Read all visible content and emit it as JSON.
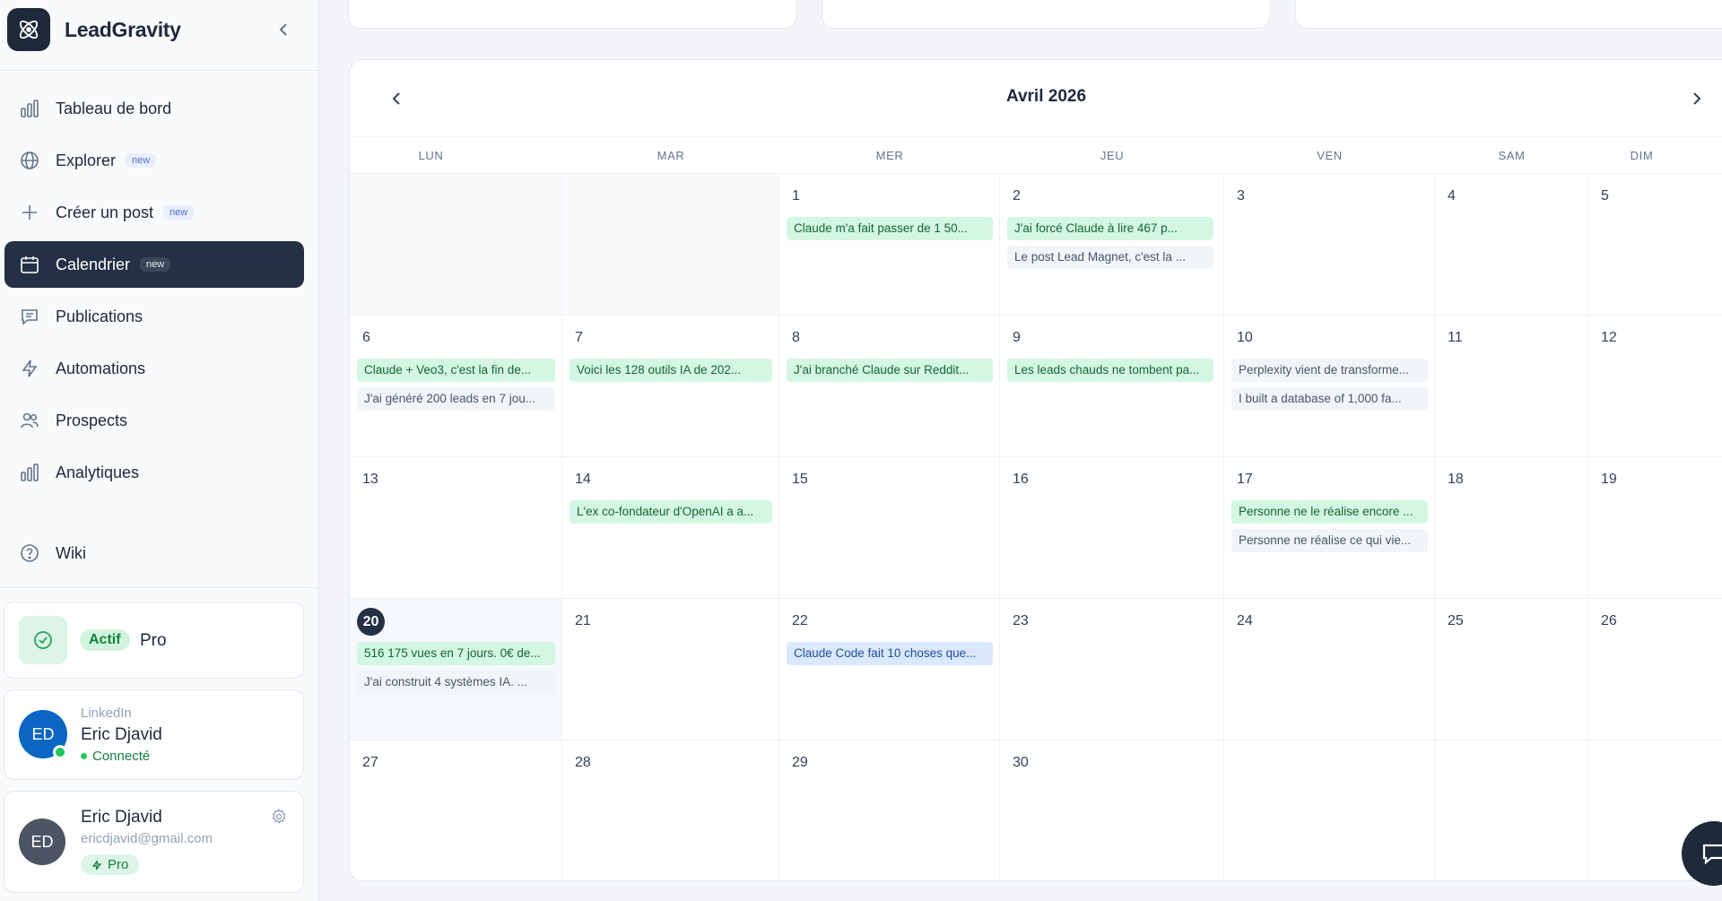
{
  "brand": {
    "name": "LeadGravity"
  },
  "nav": {
    "items": [
      {
        "id": "dashboard",
        "label": "Tableau de bord",
        "icon": "bar-chart-icon",
        "badge": ""
      },
      {
        "id": "explore",
        "label": "Explorer",
        "icon": "globe-icon",
        "badge": "new"
      },
      {
        "id": "create-post",
        "label": "Créer un post",
        "icon": "plus-icon",
        "badge": "new"
      },
      {
        "id": "calendar",
        "label": "Calendrier",
        "icon": "calendar-icon",
        "badge": "new",
        "active": true
      },
      {
        "id": "publications",
        "label": "Publications",
        "icon": "message-square-icon",
        "badge": ""
      },
      {
        "id": "automations",
        "label": "Automations",
        "icon": "lightning-icon",
        "badge": ""
      },
      {
        "id": "prospects",
        "label": "Prospects",
        "icon": "users-icon",
        "badge": ""
      },
      {
        "id": "analytics",
        "label": "Analytiques",
        "icon": "bar-chart-icon",
        "badge": ""
      }
    ],
    "wiki": {
      "label": "Wiki",
      "icon": "help-circle-icon"
    }
  },
  "plan": {
    "status": "Actif",
    "name": "Pro"
  },
  "linkedin": {
    "label": "LinkedIn",
    "initials": "ED",
    "name": "Eric Djavid",
    "status": "Connecté"
  },
  "user": {
    "initials": "ED",
    "name": "Eric Djavid",
    "email": "ericdjavid@gmail.com",
    "plan": "Pro"
  },
  "calendar": {
    "title": "Avril 2026",
    "weekdays": [
      "LUN",
      "MAR",
      "MER",
      "JEU",
      "VEN",
      "SAM",
      "DIM"
    ],
    "today": 20,
    "weeks": [
      [
        {
          "day": "",
          "events": []
        },
        {
          "day": "",
          "events": []
        },
        {
          "day": "1",
          "events": [
            {
              "text": "Claude m'a fait passer de 1 50...",
              "color": "green"
            }
          ]
        },
        {
          "day": "2",
          "events": [
            {
              "text": "J'ai forcé Claude à lire 467 p...",
              "color": "green"
            },
            {
              "text": "Le post Lead Magnet, c'est la ...",
              "color": "gray"
            }
          ]
        },
        {
          "day": "3",
          "events": []
        },
        {
          "day": "4",
          "events": []
        },
        {
          "day": "5",
          "events": []
        }
      ],
      [
        {
          "day": "6",
          "events": [
            {
              "text": "Claude + Veo3, c'est la fin de...",
              "color": "green"
            },
            {
              "text": "J'ai généré 200 leads en 7 jou...",
              "color": "gray"
            }
          ]
        },
        {
          "day": "7",
          "events": [
            {
              "text": "Voici les 128 outils IA de 202...",
              "color": "green"
            }
          ]
        },
        {
          "day": "8",
          "events": [
            {
              "text": "J'ai branché Claude sur Reddit...",
              "color": "green"
            }
          ]
        },
        {
          "day": "9",
          "events": [
            {
              "text": "Les leads chauds ne tombent pa...",
              "color": "green"
            }
          ]
        },
        {
          "day": "10",
          "events": [
            {
              "text": "Perplexity vient de transforme...",
              "color": "gray"
            },
            {
              "text": "I built a database of 1,000 fa...",
              "color": "gray"
            }
          ]
        },
        {
          "day": "11",
          "events": []
        },
        {
          "day": "12",
          "events": []
        }
      ],
      [
        {
          "day": "13",
          "events": []
        },
        {
          "day": "14",
          "events": [
            {
              "text": "L'ex co-fondateur d'OpenAI a a...",
              "color": "green"
            }
          ]
        },
        {
          "day": "15",
          "events": []
        },
        {
          "day": "16",
          "events": []
        },
        {
          "day": "17",
          "events": [
            {
              "text": "Personne ne le réalise encore ...",
              "color": "green"
            },
            {
              "text": "Personne ne réalise ce qui vie...",
              "color": "gray"
            }
          ]
        },
        {
          "day": "18",
          "events": []
        },
        {
          "day": "19",
          "events": []
        }
      ],
      [
        {
          "day": "20",
          "events": [
            {
              "text": "516 175 vues en 7 jours. 0€ de...",
              "color": "green"
            },
            {
              "text": "J'ai construit 4 systèmes IA. ...",
              "color": "gray"
            }
          ]
        },
        {
          "day": "21",
          "events": []
        },
        {
          "day": "22",
          "events": [
            {
              "text": "Claude Code fait 10 choses que...",
              "color": "blue"
            }
          ]
        },
        {
          "day": "23",
          "events": []
        },
        {
          "day": "24",
          "events": []
        },
        {
          "day": "25",
          "events": []
        },
        {
          "day": "26",
          "events": []
        }
      ],
      [
        {
          "day": "27",
          "events": []
        },
        {
          "day": "28",
          "events": []
        },
        {
          "day": "29",
          "events": []
        },
        {
          "day": "30",
          "events": []
        },
        {
          "day": "",
          "events": []
        },
        {
          "day": "",
          "events": []
        },
        {
          "day": "",
          "events": []
        }
      ]
    ]
  },
  "colors": {
    "primary": "#243044",
    "green": "#166534",
    "green_bg": "#d3f7e2",
    "blue_bg": "#dbe8fb",
    "gray_bg": "#f1f5f9"
  }
}
